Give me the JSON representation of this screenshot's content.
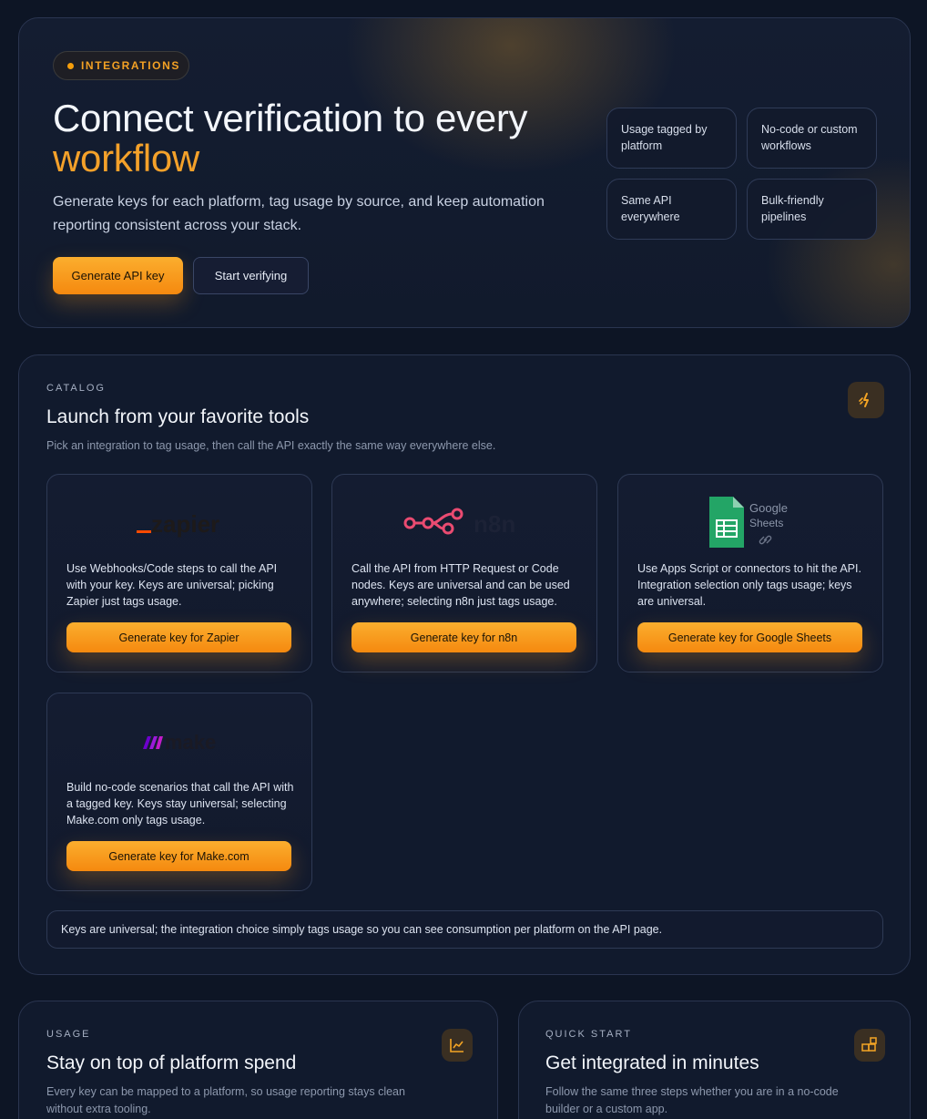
{
  "hero": {
    "badge": "INTEGRATIONS",
    "title_line1": "Connect verification to every",
    "title_accent": "workflow",
    "subtitle": "Generate keys for each platform, tag usage by source, and keep automation reporting consistent across your stack.",
    "primary_button": "Generate API key",
    "secondary_button": "Start verifying",
    "chips": [
      "Usage tagged by platform",
      "No-code or custom workflows",
      "Same API everywhere",
      "Bulk-friendly pipelines"
    ]
  },
  "catalog": {
    "eyebrow": "CATALOG",
    "title": "Launch from your favorite tools",
    "description": "Pick an integration to tag usage, then call the API exactly the same way everywhere else.",
    "icon": "plug-icon",
    "cards": [
      {
        "logo": "zapier",
        "desc": "Use Webhooks/Code steps to call the API with your key. Keys are universal; picking Zapier just tags usage.",
        "cta": "Generate key for Zapier"
      },
      {
        "logo": "n8n",
        "desc": "Call the API from HTTP Request or Code nodes. Keys are universal and can be used anywhere; selecting n8n just tags usage.",
        "cta": "Generate key for n8n"
      },
      {
        "logo": "Google Sheets",
        "desc": "Use Apps Script or connectors to hit the API. Integration selection only tags usage; keys are universal.",
        "cta": "Generate key for Google Sheets"
      },
      {
        "logo": "make",
        "desc": "Build no-code scenarios that call the API with a tagged key. Keys stay universal; selecting Make.com only tags usage.",
        "cta": "Generate key for Make.com"
      }
    ],
    "note": "Keys are universal; the integration choice simply tags usage so you can see consumption per platform on the API page.",
    "logo_text": {
      "zapier": "zapier",
      "n8n": "n8n",
      "google": "Google",
      "sheets": "Sheets",
      "make": "make"
    }
  },
  "usage": {
    "eyebrow": "USAGE",
    "title": "Stay on top of platform spend",
    "description": "Every key can be mapped to a platform, so usage reporting stays clean without extra tooling.",
    "icon": "line-chart-icon"
  },
  "quick_start": {
    "eyebrow": "QUICK START",
    "title": "Get integrated in minutes",
    "description": "Follow the same three steps whether you are in a no-code builder or a custom app.",
    "icon": "blocks-icon"
  },
  "colors": {
    "accent": "#f59e0b",
    "background": "#0d1525",
    "panel": "#111a2d",
    "zapier": "#ff4a00",
    "n8n": "#ea4b71",
    "sheets": "#23a566",
    "make": "#6d00cc"
  }
}
